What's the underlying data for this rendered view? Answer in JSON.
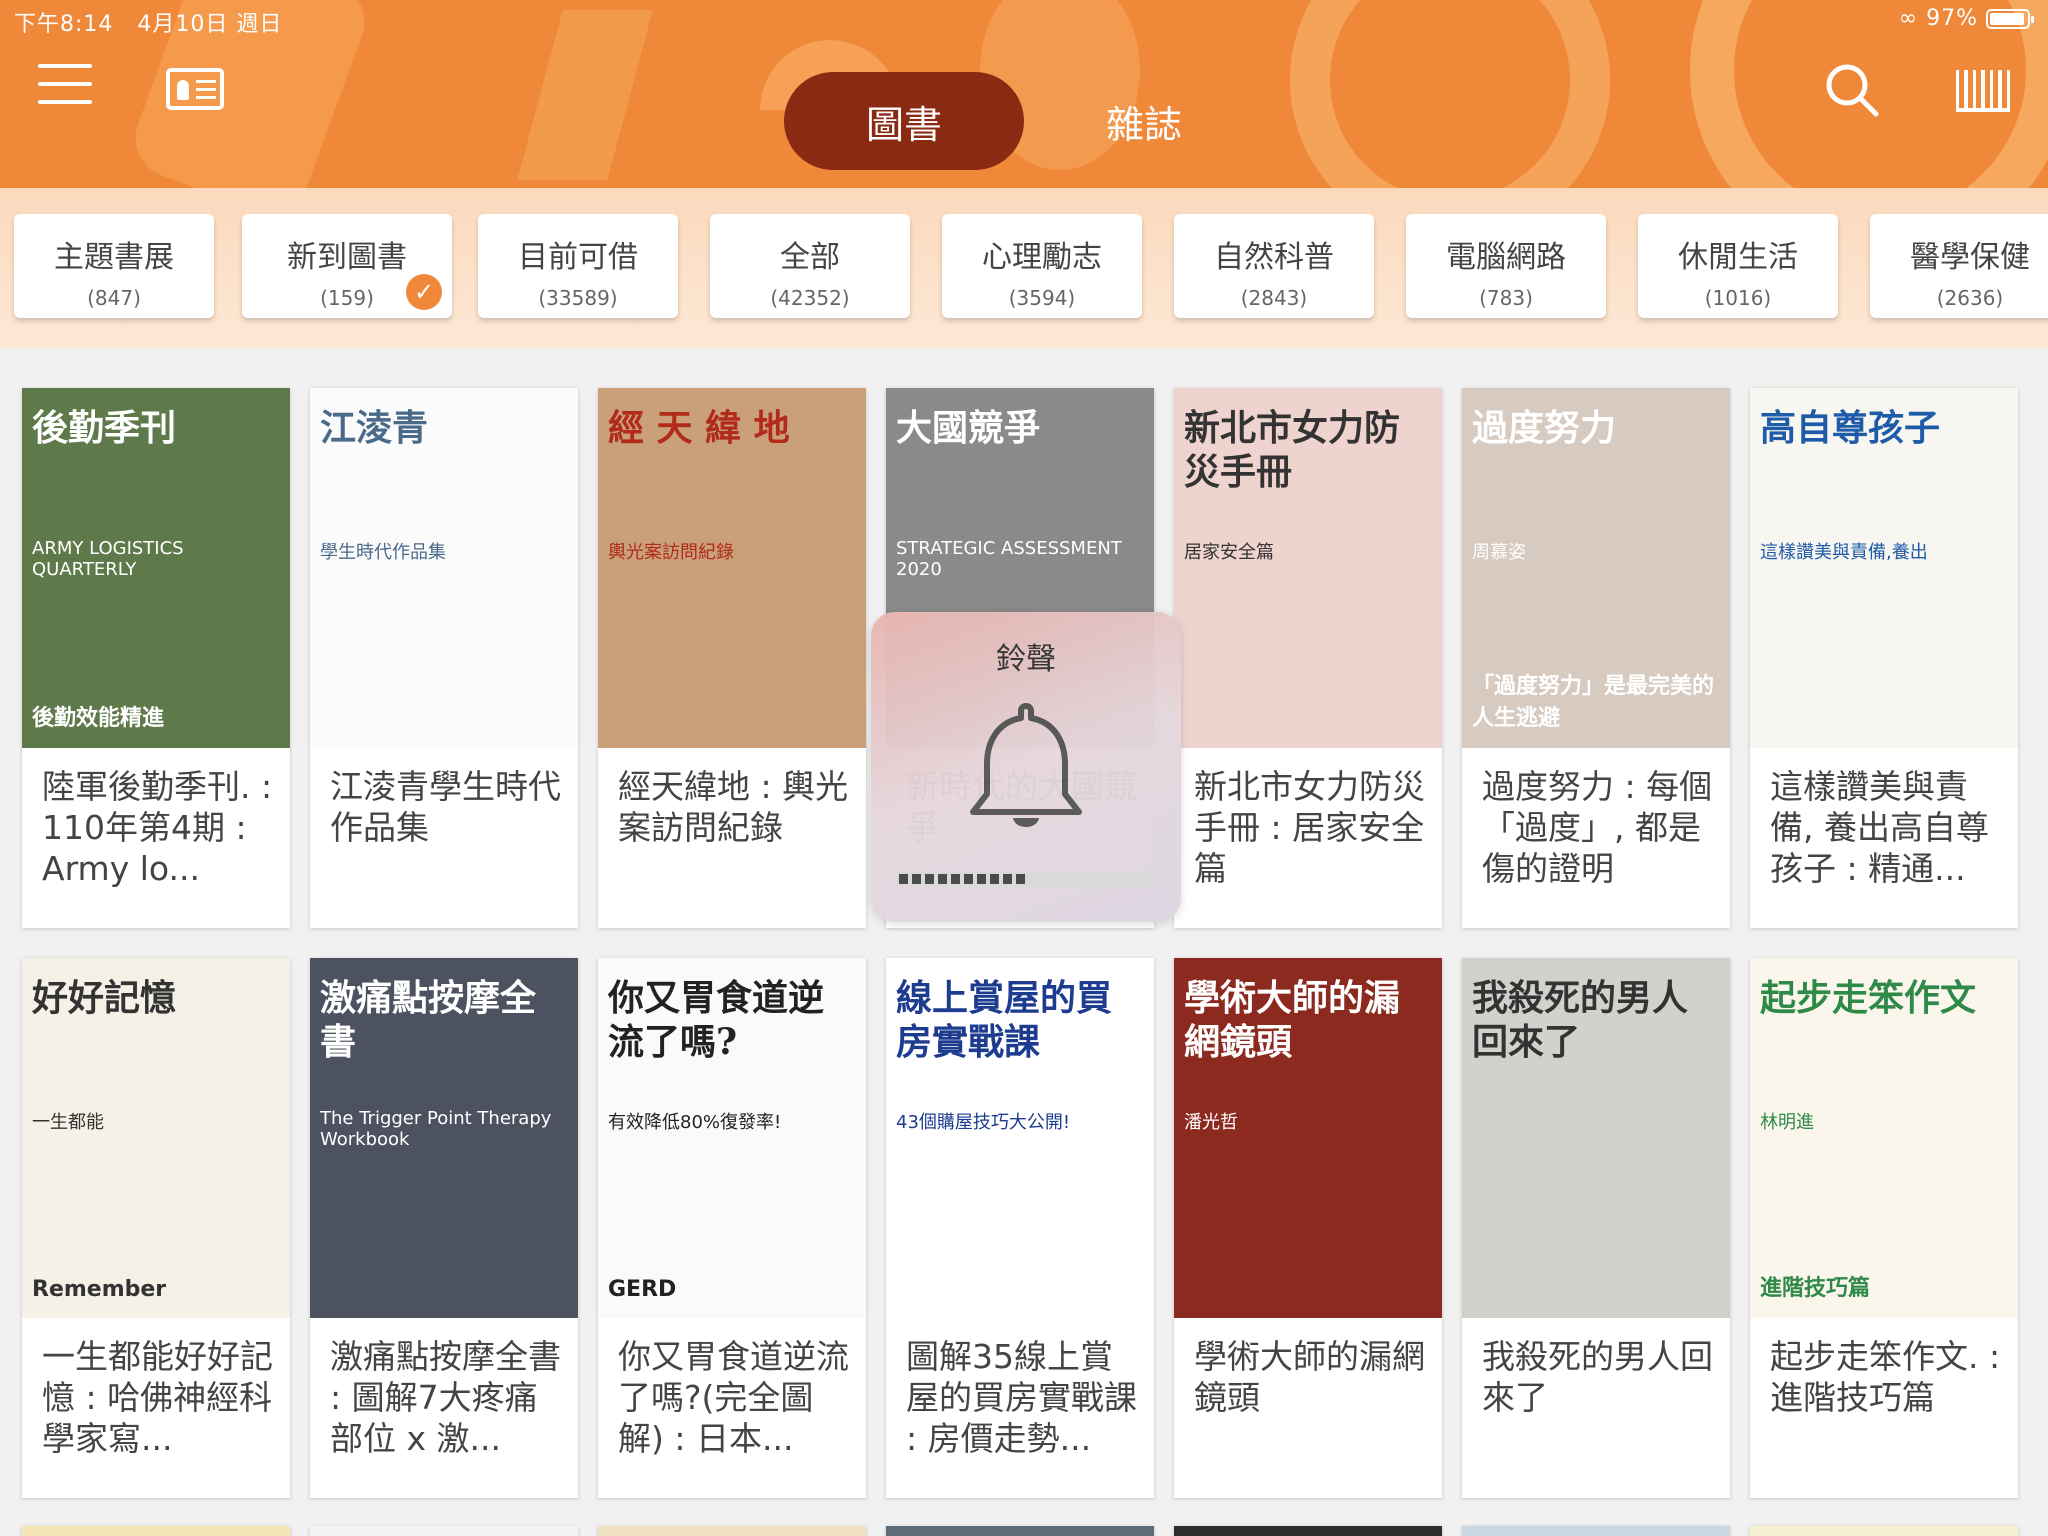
{
  "status_bar": {
    "time": "下午8:14",
    "date": "4月10日 週日",
    "battery": "97%"
  },
  "header": {
    "tabs": [
      {
        "label": "圖書",
        "active": true
      },
      {
        "label": "雜誌",
        "active": false
      }
    ],
    "icons": [
      "hamburger-menu-icon",
      "id-card-icon",
      "search-icon",
      "barcode-scan-icon"
    ]
  },
  "categories": [
    {
      "name": "主題書展",
      "count": "(847)"
    },
    {
      "name": "新到圖書",
      "count": "(159)",
      "selected": true
    },
    {
      "name": "目前可借",
      "count": "(33589)"
    },
    {
      "name": "全部",
      "count": "(42352)"
    },
    {
      "name": "心理勵志",
      "count": "(3594)"
    },
    {
      "name": "自然科普",
      "count": "(2843)"
    },
    {
      "name": "電腦網路",
      "count": "(783)"
    },
    {
      "name": "休閒生活",
      "count": "(1016)"
    },
    {
      "name": "醫學保健",
      "count": "(2636)"
    }
  ],
  "books": [
    {
      "title": "陸軍後勤季刊. : 110年第4期 : Army lo...",
      "cover_title": "後勤季刊",
      "cover_sub": "ARMY LOGISTICS QUARTERLY",
      "cover_bottom": "後勤效能精進",
      "bg": "#5f7a4a",
      "fg": "#ffffff"
    },
    {
      "title": "江淩青學生時代作品集",
      "cover_title": "江淩青",
      "cover_sub": "學生時代作品集",
      "cover_bottom": "",
      "bg": "#fbfbfb",
      "fg": "#4a6a8a"
    },
    {
      "title": "經天緯地 : 輿光案訪問紀錄",
      "cover_title": "經 天 緯 地",
      "cover_sub": "輿光案訪問紀錄",
      "cover_bottom": "",
      "bg": "#c9a07a",
      "fg": "#b12a1a"
    },
    {
      "title": "新時代的大國競爭",
      "cover_title": "大國競爭",
      "cover_sub": "STRATEGIC ASSESSMENT 2020",
      "cover_bottom": "",
      "bg": "#8a8a8a",
      "fg": "#ffffff"
    },
    {
      "title": "新北市女力防災手冊 : 居家安全篇",
      "cover_title": "新北市女力防災手冊",
      "cover_sub": "居家安全篇",
      "cover_bottom": "",
      "bg": "#efd3cf",
      "fg": "#333333"
    },
    {
      "title": "過度努力 : 每個「過度」, 都是傷的證明",
      "cover_title": "過度努力",
      "cover_sub": "周慕姿",
      "cover_bottom": "「過度努力」是最完美的人生逃避",
      "bg": "#d6cac1",
      "fg": "#ffffff"
    },
    {
      "title": "這樣讚美與責備, 養出高自尊孩子 : 精通...",
      "cover_title": "高自尊孩子",
      "cover_sub": "這樣讚美與責備,養出",
      "cover_bottom": "",
      "bg": "#f7f6f1",
      "fg": "#1e5ba8"
    },
    {
      "title": "一生都能好好記憶 : 哈佛神經科學家寫...",
      "cover_title": "好好記憶",
      "cover_sub": "一生都能",
      "cover_bottom": "Remember",
      "bg": "#f6f1e6",
      "fg": "#333333"
    },
    {
      "title": "激痛點按摩全書 : 圖解7大疼痛部位 x 激...",
      "cover_title": "激痛點按摩全書",
      "cover_sub": "The Trigger Point Therapy Workbook",
      "cover_bottom": "",
      "bg": "#4c5260",
      "fg": "#ffffff"
    },
    {
      "title": "你又胃食道逆流了嗎?(完全圖解) : 日本...",
      "cover_title": "你又胃食道逆流了嗎?",
      "cover_sub": "有效降低80%復發率!",
      "cover_bottom": "GERD",
      "bg": "#fafafa",
      "fg": "#222222"
    },
    {
      "title": "圖解35線上賞屋的買房實戰課 : 房價走勢...",
      "cover_title": "線上賞屋的買房實戰課",
      "cover_sub": "43個購屋技巧大公開!",
      "cover_bottom": "",
      "bg": "#ffffff",
      "fg": "#1d3c8f"
    },
    {
      "title": "學術大師的漏網鏡頭",
      "cover_title": "學術大師的漏網鏡頭",
      "cover_sub": "潘光哲",
      "cover_bottom": "",
      "bg": "#8d2a20",
      "fg": "#ffffff"
    },
    {
      "title": "我殺死的男人回來了",
      "cover_title": "我殺死的男人回來了",
      "cover_sub": "",
      "cover_bottom": "",
      "bg": "#cfd3cc",
      "fg": "#333333"
    },
    {
      "title": "起步走笨作文. : 進階技巧篇",
      "cover_title": "起步走笨作文",
      "cover_sub": "林明進",
      "cover_bottom": "進階技巧篇",
      "bg": "#faf6ec",
      "fg": "#2f8a4a"
    }
  ],
  "overlay": {
    "title": "鈴聲",
    "level": 0.5
  }
}
